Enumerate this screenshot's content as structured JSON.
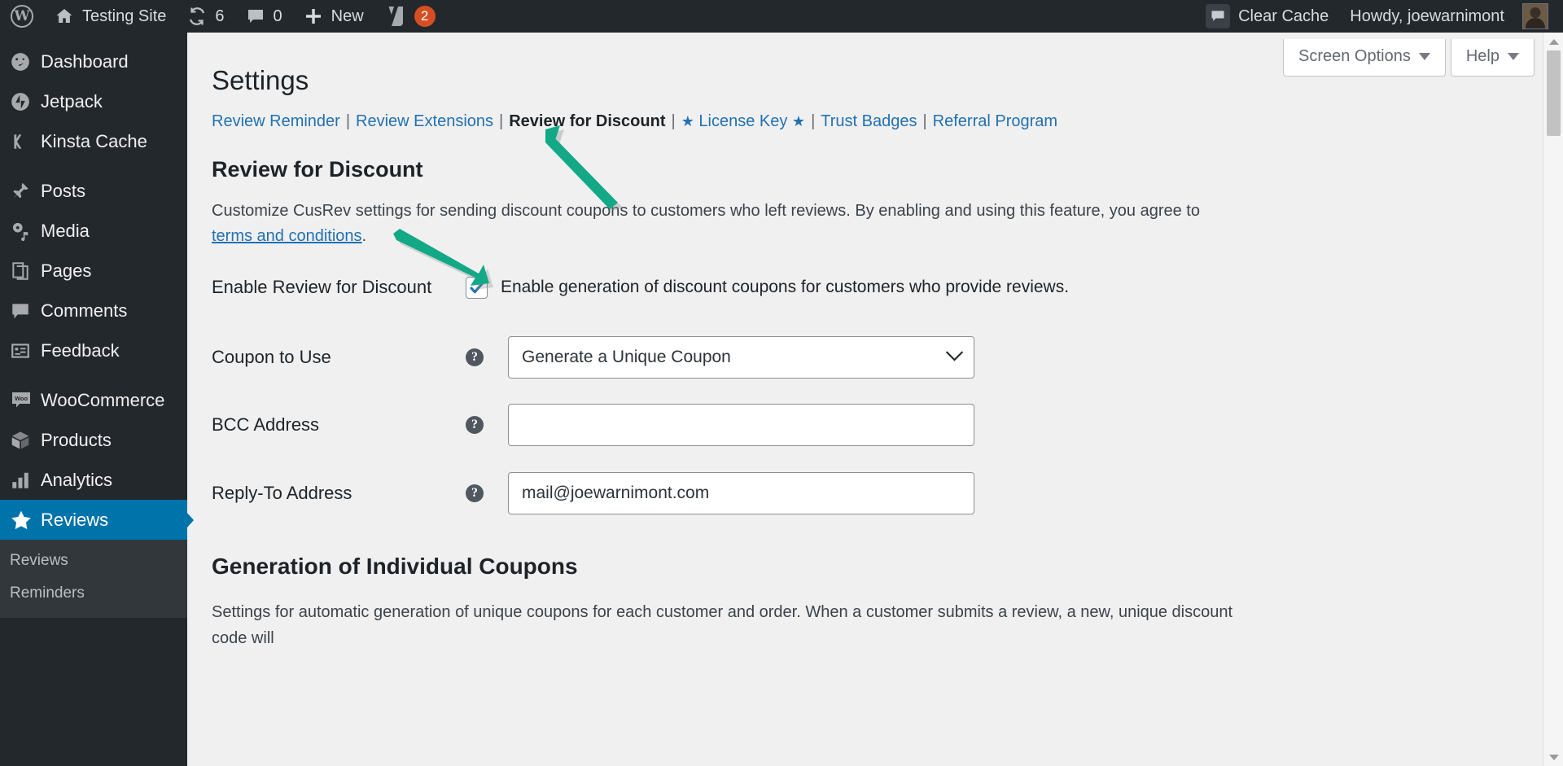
{
  "adminbar": {
    "logo_icon": "wordpress-logo-icon",
    "site": {
      "icon": "home-icon",
      "label": "Testing Site"
    },
    "updates": {
      "icon": "updates-icon",
      "count": "6"
    },
    "comments": {
      "icon": "comment-bubble-icon",
      "count": "0"
    },
    "new": {
      "icon": "plus-icon",
      "label": "New"
    },
    "yoast": {
      "icon": "yoast-seo-icon",
      "count": "2"
    },
    "clear_cache": {
      "icon": "speech-bubble-icon",
      "label": "Clear Cache"
    },
    "account": {
      "label": "Howdy, joewarnimont",
      "avatar": "user-avatar"
    }
  },
  "sidebar": {
    "items": [
      {
        "label": "Dashboard",
        "icon": "dashboard-gauge-icon",
        "current": false
      },
      {
        "label": "Jetpack",
        "icon": "jetpack-icon",
        "current": false
      },
      {
        "label": "Kinsta Cache",
        "icon": "kinsta-k-icon",
        "current": false
      },
      {
        "label": "Posts",
        "icon": "pushpin-icon",
        "current": false
      },
      {
        "label": "Media",
        "icon": "media-icon",
        "current": false
      },
      {
        "label": "Pages",
        "icon": "pages-icon",
        "current": false
      },
      {
        "label": "Comments",
        "icon": "comment-bubble-icon",
        "current": false
      },
      {
        "label": "Feedback",
        "icon": "feedback-form-icon",
        "current": false
      },
      {
        "label": "WooCommerce",
        "icon": "woocommerce-icon",
        "current": false
      },
      {
        "label": "Products",
        "icon": "products-box-icon",
        "current": false
      },
      {
        "label": "Analytics",
        "icon": "bar-chart-icon",
        "current": false
      },
      {
        "label": "Reviews",
        "icon": "star-icon",
        "current": true
      }
    ],
    "submenu": [
      {
        "label": "Reviews"
      },
      {
        "label": "Reminders"
      }
    ]
  },
  "screen_meta": {
    "screen_options": "Screen Options",
    "help": "Help"
  },
  "page": {
    "title": "Settings",
    "tabs": [
      {
        "label": "Review Reminder",
        "current": false,
        "stars": false
      },
      {
        "label": "Review Extensions",
        "current": false,
        "stars": false
      },
      {
        "label": "Review for Discount",
        "current": true,
        "stars": false
      },
      {
        "label": "License Key",
        "current": false,
        "stars": true
      },
      {
        "label": "Trust Badges",
        "current": false,
        "stars": false
      },
      {
        "label": "Referral Program",
        "current": false,
        "stars": false
      }
    ],
    "tab_separator": "|",
    "star_glyph": "★",
    "section_title": "Review for Discount",
    "description_before": "Customize CusRev settings for sending discount coupons to customers who left reviews. By enabling and using this feature, you agree to ",
    "description_link": "terms and conditions",
    "description_after": ".",
    "fields": {
      "enable": {
        "label": "Enable Review for Discount",
        "checkbox_label": "Enable generation of discount coupons for customers who provide reviews.",
        "checked": true
      },
      "coupon": {
        "label": "Coupon to Use",
        "help": "?",
        "value": "Generate a Unique Coupon",
        "options": [
          "Generate a Unique Coupon"
        ]
      },
      "bcc": {
        "label": "BCC Address",
        "help": "?",
        "value": "",
        "placeholder": ""
      },
      "reply_to": {
        "label": "Reply-To Address",
        "help": "?",
        "value": "mail@joewarnimont.com",
        "placeholder": ""
      }
    },
    "subsection_title": "Generation of Individual Coupons",
    "subsection_description": "Settings for automatic generation of unique coupons for each customer and order. When a customer submits a review, a new, unique discount code will"
  },
  "annotations": {
    "arrow_color": "#13a886",
    "arrows": [
      {
        "name": "arrow-pointing-to-review-for-discount-tab"
      },
      {
        "name": "arrow-pointing-to-enable-checkbox"
      }
    ]
  },
  "colors": {
    "admin_bar_bg": "#23282d",
    "sidebar_bg": "#23282d",
    "current_menu_bg": "#0073aa",
    "link_blue": "#2271b1",
    "content_bg": "#f0f0f1",
    "badge_orange": "#d54e21",
    "checkbox_blue": "#2271b1"
  }
}
